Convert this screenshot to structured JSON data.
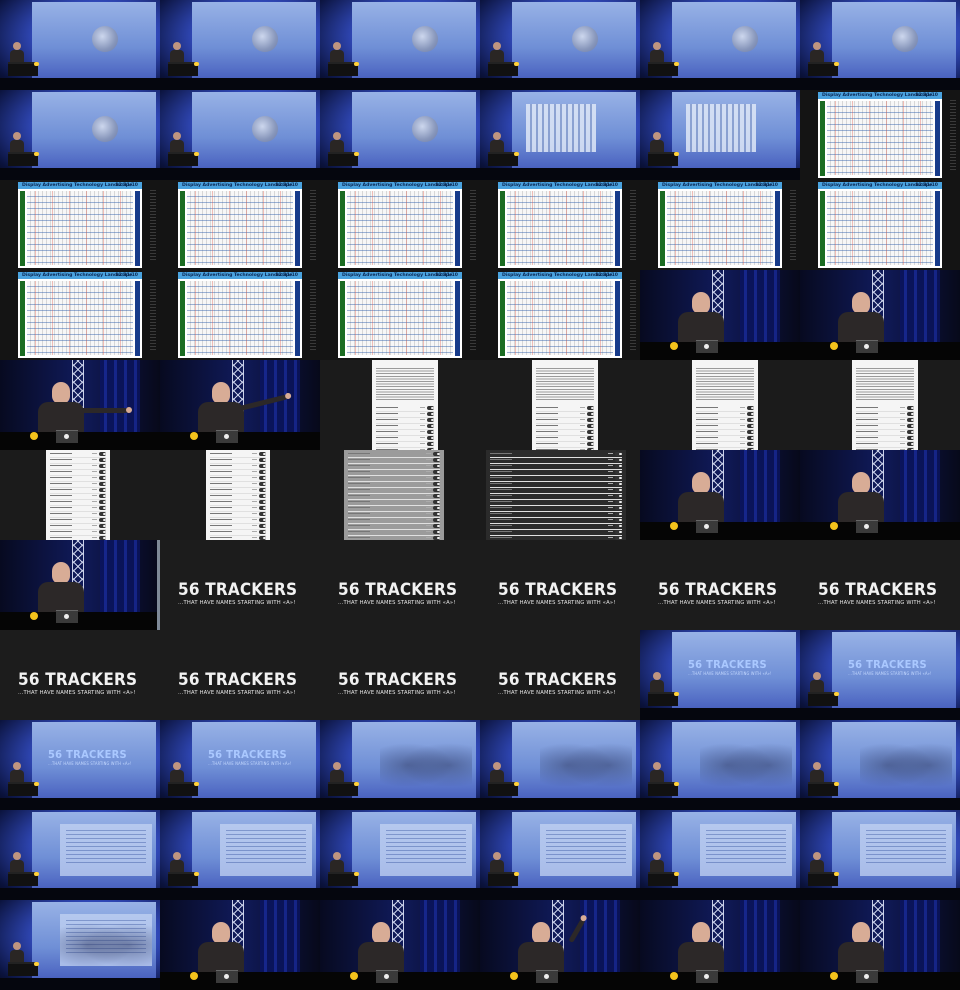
{
  "landscape_slide": {
    "title": "Display Advertising Technology Landscape",
    "date": "12/31/10"
  },
  "trackers_slide": {
    "title": "56 TRACKERS",
    "subtitle": "...THAT HAVE NAMES STARTING WITH «A»!"
  },
  "cells": [
    {
      "type": "stage",
      "variant": "globe"
    },
    {
      "type": "stage",
      "variant": "globe"
    },
    {
      "type": "stage",
      "variant": "globe"
    },
    {
      "type": "stage",
      "variant": "globe"
    },
    {
      "type": "stage",
      "variant": "globe"
    },
    {
      "type": "stage",
      "variant": "globe"
    },
    {
      "type": "stage",
      "variant": "globe"
    },
    {
      "type": "stage",
      "variant": "globe"
    },
    {
      "type": "stage",
      "variant": "globe"
    },
    {
      "type": "stage",
      "variant": "poster"
    },
    {
      "type": "stage",
      "variant": "poster"
    },
    {
      "type": "landscape",
      "edge": true
    },
    {
      "type": "landscape",
      "edge": true
    },
    {
      "type": "landscape",
      "edge": true
    },
    {
      "type": "landscape",
      "edge": true
    },
    {
      "type": "landscape",
      "edge": true
    },
    {
      "type": "landscape",
      "edge": true
    },
    {
      "type": "landscape",
      "edge": false
    },
    {
      "type": "landscape",
      "edge": true
    },
    {
      "type": "landscape",
      "edge": true
    },
    {
      "type": "landscape",
      "edge": true
    },
    {
      "type": "landscape",
      "edge": true
    },
    {
      "type": "close",
      "pose": "neutral"
    },
    {
      "type": "close",
      "pose": "neutral"
    },
    {
      "type": "close",
      "pose": "point-right"
    },
    {
      "type": "close",
      "pose": "point-right-up"
    },
    {
      "type": "doc",
      "part": "top"
    },
    {
      "type": "doc",
      "part": "top"
    },
    {
      "type": "doc",
      "part": "top"
    },
    {
      "type": "doc",
      "part": "top"
    },
    {
      "type": "doc",
      "part": "list",
      "tone": "light"
    },
    {
      "type": "doc",
      "part": "list",
      "tone": "light"
    },
    {
      "type": "doc",
      "part": "list",
      "tone": "gray"
    },
    {
      "type": "doc",
      "part": "list",
      "tone": "dark"
    },
    {
      "type": "close",
      "pose": "neutral"
    },
    {
      "type": "close",
      "pose": "neutral"
    },
    {
      "type": "close",
      "pose": "neutral",
      "edge": true
    },
    {
      "type": "trackers"
    },
    {
      "type": "trackers"
    },
    {
      "type": "trackers"
    },
    {
      "type": "trackers"
    },
    {
      "type": "trackers"
    },
    {
      "type": "trackers"
    },
    {
      "type": "trackers"
    },
    {
      "type": "trackers"
    },
    {
      "type": "trackers"
    },
    {
      "type": "stage",
      "variant": "title"
    },
    {
      "type": "stage",
      "variant": "title"
    },
    {
      "type": "stage",
      "variant": "title"
    },
    {
      "type": "stage",
      "variant": "title"
    },
    {
      "type": "stage",
      "variant": "overlay"
    },
    {
      "type": "stage",
      "variant": "overlay"
    },
    {
      "type": "stage",
      "variant": "overlay"
    },
    {
      "type": "stage",
      "variant": "overlay"
    },
    {
      "type": "stage",
      "variant": "doc"
    },
    {
      "type": "stage",
      "variant": "doc"
    },
    {
      "type": "stage",
      "variant": "doc"
    },
    {
      "type": "stage",
      "variant": "doc"
    },
    {
      "type": "stage",
      "variant": "doc"
    },
    {
      "type": "stage",
      "variant": "doc"
    },
    {
      "type": "stage",
      "variant": "overlay-doc"
    },
    {
      "type": "close",
      "pose": "neutral"
    },
    {
      "type": "close",
      "pose": "neutral"
    },
    {
      "type": "close",
      "pose": "raise-hand"
    },
    {
      "type": "close",
      "pose": "neutral"
    },
    {
      "type": "close",
      "pose": "neutral"
    }
  ]
}
